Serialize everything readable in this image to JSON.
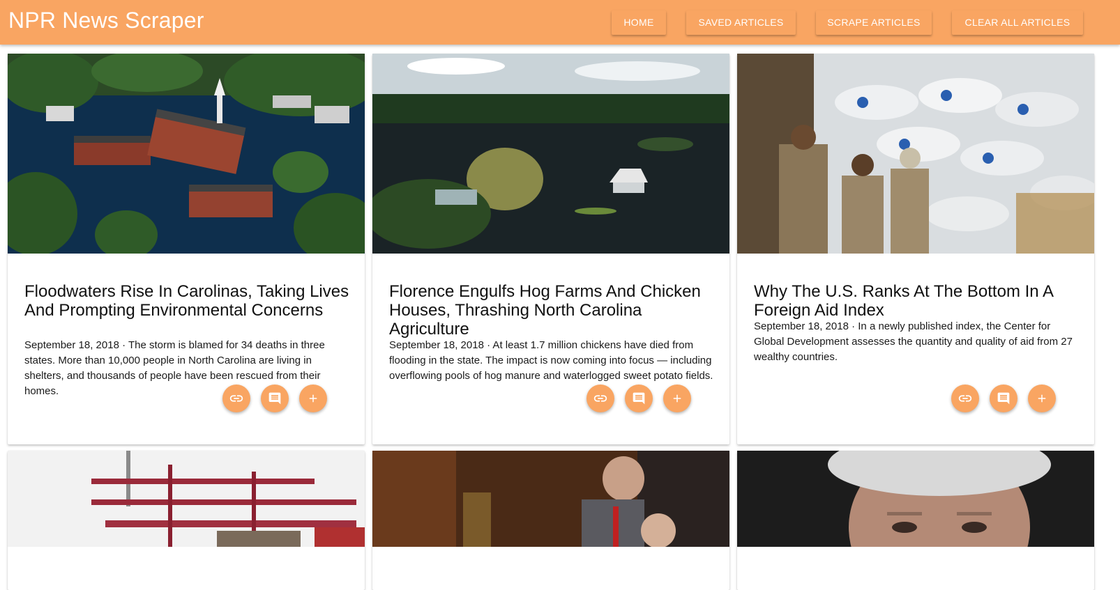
{
  "brand": "NPR News Scraper",
  "nav": {
    "home": "HOME",
    "saved": "SAVED ARTICLES",
    "scrape": "SCRAPE ARTICLES",
    "clear": "CLEAR ALL ARTICLES"
  },
  "colors": {
    "accent": "#f9a562",
    "text": "#111111"
  },
  "articles": [
    {
      "title": "Floodwaters Rise In Carolinas, Taking Lives And Prompting Environmental Concerns",
      "date": "September 18, 2018",
      "summary": "The storm is blamed for 34 deaths in three states. More than 10,000 people in North Carolina are living in shelters, and thousands of people have been rescued from their homes.",
      "teaser": "September 18, 2018 · The storm is blamed for 34 deaths in three states. More than 10,000 people in North Carolina are living in shelters, and thousands of people have been rescued from their homes.",
      "image": "aerial view of flooded town with church and brick buildings"
    },
    {
      "title": "Florence Engulfs Hog Farms And Chicken Houses, Thrashing North Carolina Agriculture",
      "date": "September 18, 2018",
      "summary": "At least 1.7 million chickens have died from flooding in the state. The impact is now coming into focus — including overflowing pools of hog manure and waterlogged sweet potato fields.",
      "teaser": "September 18, 2018 · At least 1.7 million chickens have died from flooding in the state. The impact is now coming into focus — including overflowing pools of hog manure and waterlogged sweet potato fields.",
      "image": "flooded farmland with trees and a submerged house"
    },
    {
      "title": "Why The U.S. Ranks At The Bottom In A Foreign Aid Index",
      "date": "September 18, 2018",
      "summary": "In a newly published index, the Center for Global Development assesses the quantity and quality of aid from 27 wealthy countries.",
      "teaser": "September 18, 2018 · In a newly published index, the Center for Global Development assesses the quantity and quality of aid from 27 wealthy countries.",
      "image": "workers loading USAID grain sacks onto a truck"
    },
    {
      "image": "shipping port cranes"
    },
    {
      "image": "man in suit at a hearing"
    },
    {
      "image": "close-up portrait of a gray-haired man"
    }
  ],
  "card_actions": {
    "link_icon": "link-icon",
    "comment_icon": "comment-icon",
    "add_icon": "add-icon"
  }
}
